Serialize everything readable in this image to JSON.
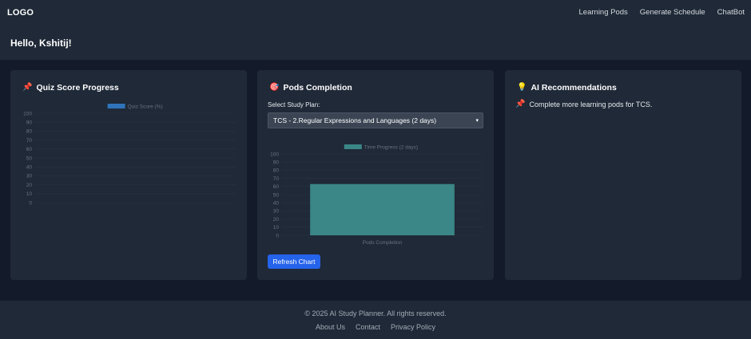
{
  "nav": {
    "logo": "LOGO",
    "links": [
      "Learning Pods",
      "Generate Schedule",
      "ChatBot"
    ]
  },
  "greeting": "Hello, Kshitij!",
  "quiz_card": {
    "title": "Quiz Score Progress",
    "icon": "pushpin-icon"
  },
  "pods_card": {
    "title": "Pods Completion",
    "icon": "target-icon",
    "select_label": "Select Study Plan:",
    "selected_plan": "TCS - 2.Regular Expressions and Languages (2 days)",
    "refresh_label": "Refresh Chart"
  },
  "ai_card": {
    "title": "AI Recommendations",
    "icon": "lightbulb-icon",
    "items": [
      "Complete more learning pods for TCS."
    ],
    "item_icon": "pushpin-icon"
  },
  "footer": {
    "copyright": "© 2025 AI Study Planner. All rights reserved.",
    "links": [
      "About Us",
      "Contact",
      "Privacy Policy"
    ]
  },
  "chart_data": [
    {
      "type": "bar",
      "categories": [],
      "series": [
        {
          "name": "Quiz Score (%)",
          "values": []
        }
      ],
      "title": "",
      "xlabel": "",
      "ylabel": "",
      "ylim": [
        0,
        100
      ],
      "yticks": [
        0,
        10,
        20,
        30,
        40,
        50,
        60,
        70,
        80,
        90,
        100
      ],
      "grid": true,
      "legend": "top",
      "color": "#2f73b8"
    },
    {
      "type": "bar",
      "categories": [
        "Pods Completion"
      ],
      "series": [
        {
          "name": "Time Progress (2 days)",
          "values": [
            63
          ]
        }
      ],
      "title": "",
      "xlabel": "",
      "ylabel": "",
      "ylim": [
        0,
        100
      ],
      "yticks": [
        0,
        10,
        20,
        30,
        40,
        50,
        60,
        70,
        80,
        90,
        100
      ],
      "grid": true,
      "legend": "top",
      "color": "#3b8686"
    }
  ]
}
